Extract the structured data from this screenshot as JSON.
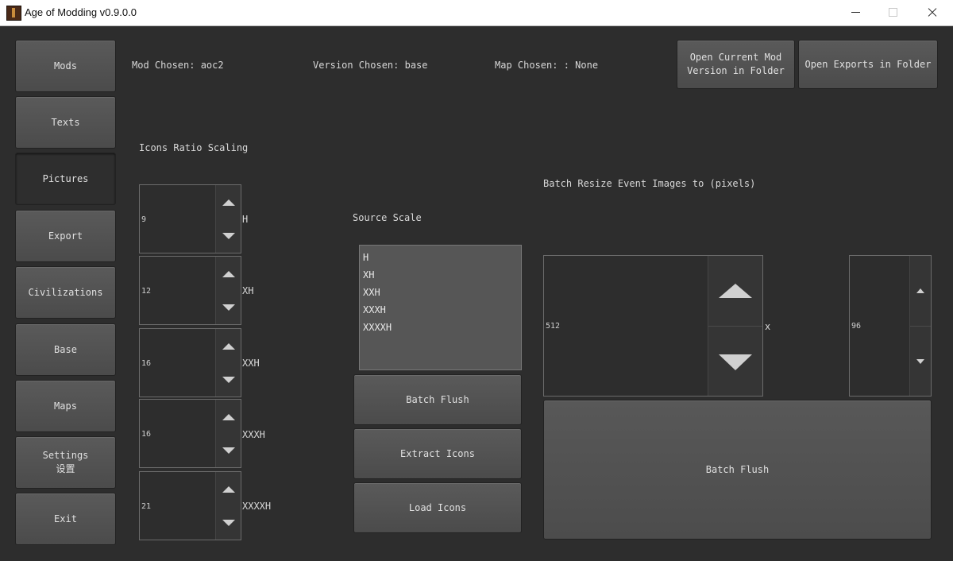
{
  "window": {
    "title": "Age of Modding v0.9.0.0"
  },
  "sidebar": {
    "items": [
      {
        "label": "Mods"
      },
      {
        "label": "Texts"
      },
      {
        "label": "Pictures"
      },
      {
        "label": "Export"
      },
      {
        "label": "Civilizations"
      },
      {
        "label": "Base"
      },
      {
        "label": "Maps"
      },
      {
        "label": "Settings\n设置"
      },
      {
        "label": "Exit"
      }
    ],
    "active": "Pictures"
  },
  "header": {
    "mod_chosen": "Mod Chosen: aoc2",
    "version_chosen": "Version Chosen: base",
    "map_chosen": "Map Chosen: : None",
    "open_current_mod": "Open Current Mod\nVersion in Folder",
    "open_exports": "Open Exports in Folder"
  },
  "icons_scaling": {
    "title": "Icons Ratio Scaling",
    "spinners": [
      {
        "value": "9",
        "unit": "H"
      },
      {
        "value": "12",
        "unit": "XH"
      },
      {
        "value": "16",
        "unit": "XXH"
      },
      {
        "value": "16",
        "unit": "XXXH"
      },
      {
        "value": "21",
        "unit": "XXXXH"
      }
    ]
  },
  "source_scale": {
    "title": "Source Scale",
    "options": [
      "H",
      "XH",
      "XXH",
      "XXXH",
      "XXXXH"
    ],
    "batch_flush": "Batch Flush",
    "extract_icons": "Extract Icons",
    "load_icons": "Load Icons"
  },
  "batch_resize": {
    "title": "Batch Resize Event Images to (pixels)",
    "width": "512",
    "separator": "x",
    "height": "96",
    "batch_flush": "Batch Flush"
  }
}
